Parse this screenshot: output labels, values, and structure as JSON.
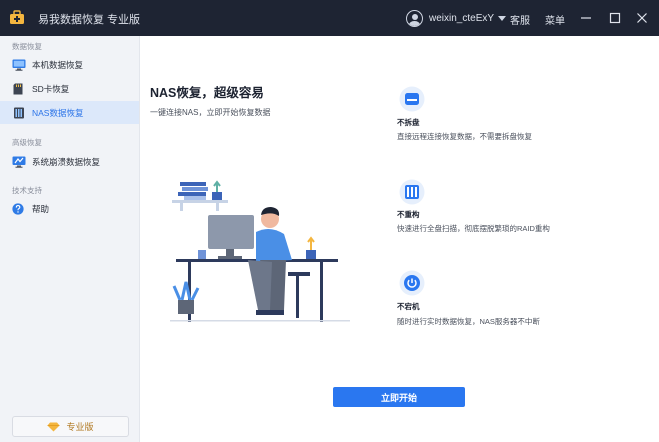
{
  "app": {
    "title": "易我数据恢复 专业版"
  },
  "titlebar": {
    "username": "weixin_cteExY",
    "links": [
      "客服",
      "菜单"
    ],
    "window_buttons": [
      "minimize-icon",
      "maximize-icon",
      "close-icon"
    ]
  },
  "sidebar": {
    "groups": [
      {
        "label": "数据恢复",
        "items": [
          {
            "label": "本机数据恢复",
            "icon": "monitor-icon",
            "active": false
          },
          {
            "label": "SD卡恢复",
            "icon": "sd-card-icon",
            "active": false
          },
          {
            "label": "NAS数据恢复",
            "icon": "nas-icon",
            "active": true
          }
        ]
      },
      {
        "label": "高级恢复",
        "items": [
          {
            "label": "系统崩溃数据恢复",
            "icon": "system-crash-icon",
            "active": false
          }
        ]
      },
      {
        "label": "技术支持",
        "items": [
          {
            "label": "帮助",
            "icon": "help-icon",
            "active": false
          }
        ]
      }
    ],
    "pro_button": {
      "label": "专业版",
      "icon": "diamond-icon"
    }
  },
  "main": {
    "title": "NAS恢复，超级容易",
    "subtitle": "一键连接NAS，立即开始恢复数据",
    "features": [
      {
        "title": "不拆盘",
        "desc": "直接远程连接恢复数据，不需要拆盘恢复",
        "icon": "disk-icon"
      },
      {
        "title": "不重构",
        "desc": "快速进行全盘扫描，彻底摆脱繁琐的RAID重构",
        "icon": "raid-icon"
      },
      {
        "title": "不宕机",
        "desc": "随时进行实时数据恢复，NAS服务器不中断",
        "icon": "power-icon"
      }
    ],
    "start_button": "立即开始"
  },
  "colors": {
    "accent": "#2a77f0",
    "titlebar": "#1e2433",
    "sidebar": "#f1f3f7",
    "active_bg": "#dce8fa"
  }
}
